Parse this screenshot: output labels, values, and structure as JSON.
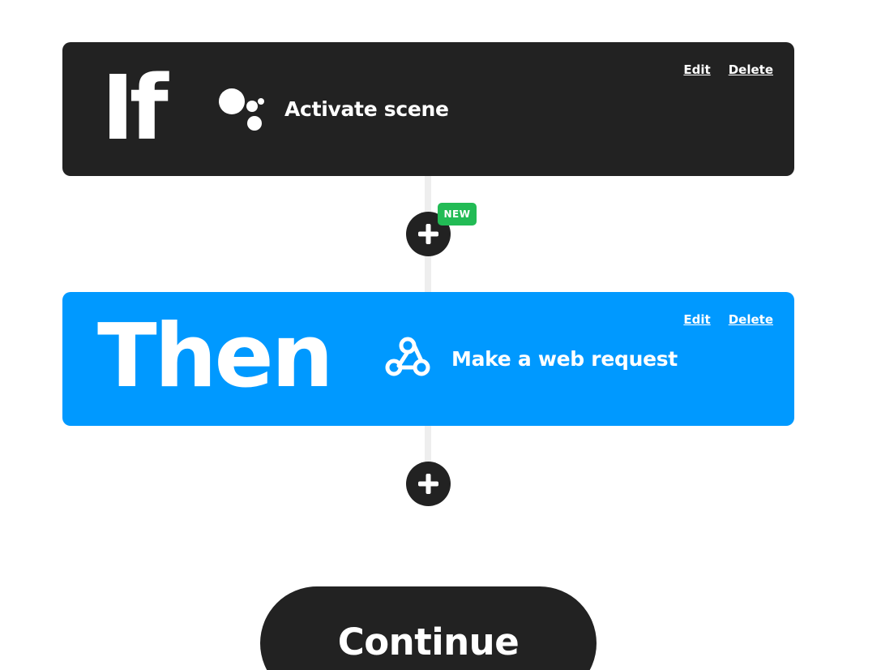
{
  "trigger": {
    "keyword": "If",
    "service_icon": "google-assistant-icon",
    "action_label": "Activate scene",
    "edit_label": "Edit",
    "delete_label": "Delete",
    "background": "#222222"
  },
  "action": {
    "keyword": "Then",
    "service_icon": "webhooks-icon",
    "action_label": "Make a web request",
    "edit_label": "Edit",
    "delete_label": "Delete",
    "background": "#0099ff"
  },
  "add_query": {
    "icon": "plus-icon",
    "badge": "NEW",
    "badge_color": "#22bb55"
  },
  "add_action": {
    "icon": "plus-icon"
  },
  "footer": {
    "continue_label": "Continue"
  }
}
